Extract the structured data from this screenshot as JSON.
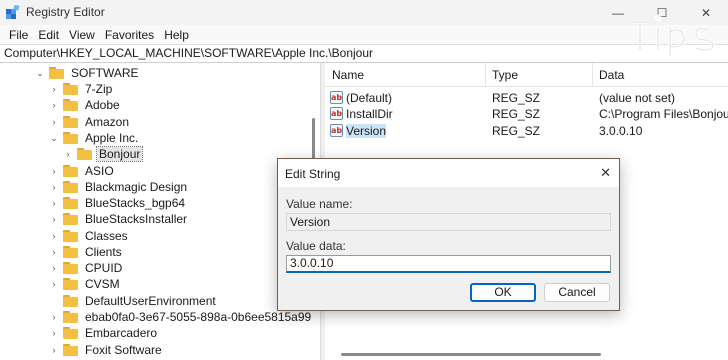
{
  "window": {
    "title": "Registry Editor"
  },
  "menu": [
    "File",
    "Edit",
    "View",
    "Favorites",
    "Help"
  ],
  "address": "Computer\\HKEY_LOCAL_MACHINE\\SOFTWARE\\Apple Inc.\\Bonjour",
  "tree": {
    "rows": [
      {
        "label": "SOFTWARE",
        "expanded": true
      },
      {
        "label": "7-Zip",
        "expanded": false
      },
      {
        "label": "Adobe",
        "expanded": false
      },
      {
        "label": "Amazon",
        "expanded": false
      },
      {
        "label": "Apple Inc.",
        "expanded": true
      },
      {
        "label": "Bonjour",
        "expanded": false,
        "selected": true
      },
      {
        "label": "ASIO",
        "expanded": false
      },
      {
        "label": "Blackmagic Design",
        "expanded": false
      },
      {
        "label": "BlueStacks_bgp64",
        "expanded": false
      },
      {
        "label": "BlueStacksInstaller",
        "expanded": false
      },
      {
        "label": "Classes",
        "expanded": false
      },
      {
        "label": "Clients",
        "expanded": false
      },
      {
        "label": "CPUID",
        "expanded": false
      },
      {
        "label": "CVSM",
        "expanded": false
      },
      {
        "label": "DefaultUserEnvironment",
        "expanded": false
      },
      {
        "label": "ebab0fa0-3e67-5055-898a-0b6ee5815a99",
        "expanded": false
      },
      {
        "label": "Embarcadero",
        "expanded": false
      },
      {
        "label": "Foxit Software",
        "expanded": false
      }
    ]
  },
  "list": {
    "headers": {
      "name": "Name",
      "type": "Type",
      "data": "Data"
    },
    "rows": [
      {
        "name": "(Default)",
        "type": "REG_SZ",
        "data": "(value not set)",
        "icon": "ab-string-icon"
      },
      {
        "name": "InstallDir",
        "type": "REG_SZ",
        "data": "C:\\Program Files\\Bonjour\\",
        "icon": "ab-string-icon"
      },
      {
        "name": "Version",
        "type": "REG_SZ",
        "data": "3.0.0.10",
        "icon": "ab-string-icon",
        "selected": true
      }
    ]
  },
  "dialog": {
    "title": "Edit String",
    "close_glyph": "✕",
    "value_name_label": "Value name:",
    "value_name": "Version",
    "value_data_label": "Value data:",
    "value_data": "3.0.0.10",
    "ok_label": "OK",
    "cancel_label": "Cancel"
  },
  "colors": {
    "accent": "#0067c0",
    "folder": "#f4c042",
    "dialog_border": "#7a5a43"
  }
}
